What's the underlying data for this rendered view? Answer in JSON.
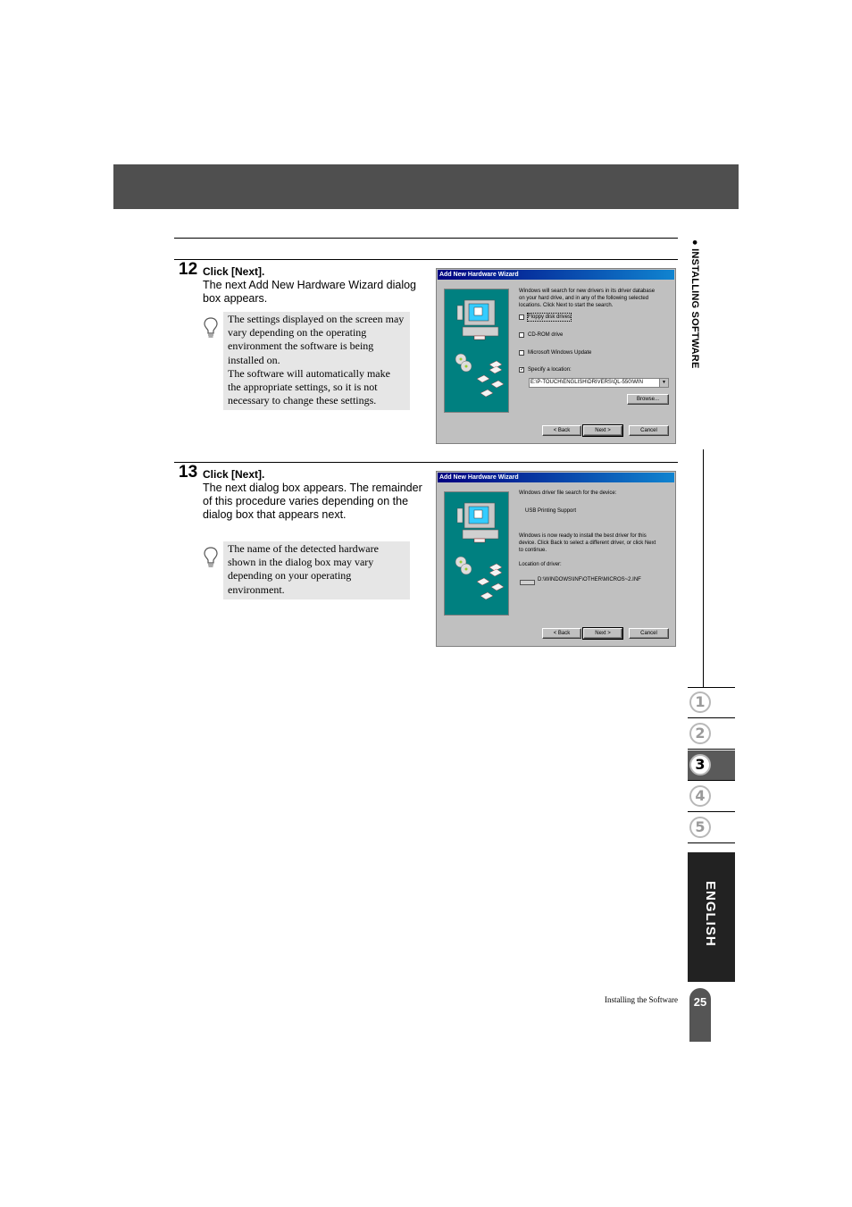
{
  "side_section": {
    "bullet": "●",
    "label": "INSTALLING SOFTWARE"
  },
  "steps": [
    {
      "number": "12",
      "title": "Click [Next].",
      "body": "The next Add New Hardware Wizard dialog box appears.",
      "tip_icon": "lightbulb-icon",
      "tip_lines": [
        "The settings displayed on the screen may",
        "vary depending on the operating",
        "environment the software is being",
        "installed on.",
        "The software will automatically make",
        "the appropriate settings, so it is not",
        "necessary to change these settings."
      ],
      "dialog": {
        "title": "Add New Hardware Wizard",
        "intro_lines": [
          "Windows will search for new drivers in its driver database",
          "on your hard drive, and in any of the following selected",
          "locations. Click Next to start the search."
        ],
        "options": [
          {
            "label": "Floppy disk drives",
            "checked": false
          },
          {
            "label": "CD-ROM drive",
            "checked": false
          },
          {
            "label": "Microsoft Windows Update",
            "checked": false
          },
          {
            "label": "Specify a location:",
            "checked": true
          }
        ],
        "location_value": "E:\\P-TOUCH\\ENGLISH\\DRIVERS\\QL-550\\WIN",
        "browse_label": "Browse...",
        "back_label": "< Back",
        "next_label": "Next >",
        "cancel_label": "Cancel"
      }
    },
    {
      "number": "13",
      "title": "Click [Next].",
      "body": "The next dialog box appears. The remainder of this procedure varies depending on the dialog box that appears next.",
      "tip_icon": "lightbulb-icon",
      "tip_lines": [
        "The name of the detected hardware",
        "shown in the dialog box may vary",
        "depending on your operating",
        "environment."
      ],
      "dialog": {
        "title": "Add New Hardware Wizard",
        "search_label": "Windows driver file search for the device:",
        "device_name": "USB Printing Support",
        "ready_lines": [
          "Windows is now ready to install the best driver for this",
          "device. Click Back to select a different driver, or click Next",
          "to continue."
        ],
        "location_label": "Location of driver:",
        "driver_path": "D:\\WINDOWS\\INF\\OTHER\\MICROS~2.INF",
        "back_label": "< Back",
        "next_label": "Next >",
        "cancel_label": "Cancel"
      }
    }
  ],
  "chapters": [
    {
      "label": "1",
      "active": false
    },
    {
      "label": "2",
      "active": false
    },
    {
      "label": "3",
      "active": true
    },
    {
      "label": "4",
      "active": false
    },
    {
      "label": "5",
      "active": false
    }
  ],
  "language_tab": "ENGLISH",
  "footer": {
    "section_title": "Installing the Software",
    "page_number": "25"
  },
  "colors": {
    "header_band": "#4f4f4f",
    "tip_background": "#e6e6e6",
    "dialog_title": "#000080",
    "wizard_art": "#008080",
    "active_chapter": "#5a5a5a",
    "language_tab": "#222222"
  }
}
